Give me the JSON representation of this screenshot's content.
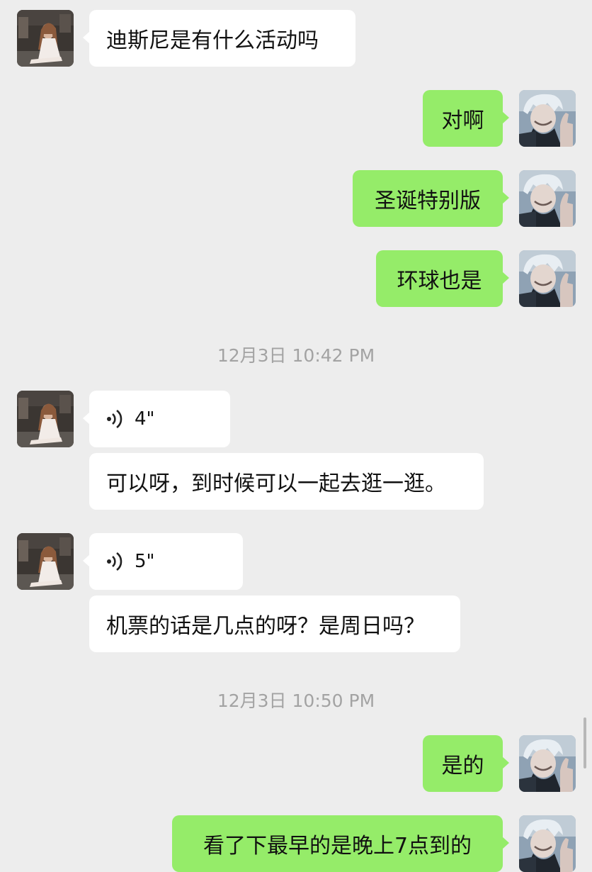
{
  "messages": [
    {
      "text": "迪斯尼是有什么活动吗"
    },
    {
      "text": "对啊"
    },
    {
      "text": "圣诞特别版"
    },
    {
      "text": "环球也是"
    },
    {
      "text": "可以呀，到时候可以一起去逛一逛。"
    },
    {
      "text": "机票的话是几点的呀？是周日吗？"
    },
    {
      "text": "是的"
    },
    {
      "text": "看了下最早的是晚上7点到的"
    }
  ],
  "voice_messages": [
    {
      "duration": "4\""
    },
    {
      "duration": "5\""
    }
  ],
  "timestamps": [
    {
      "text": "12月3日 10:42 PM"
    },
    {
      "text": "12月3日 10:50 PM"
    }
  ],
  "colors": {
    "background": "#ededed",
    "incoming_bubble": "#ffffff",
    "outgoing_bubble": "#95ec69",
    "timestamp_text": "#a3a3a3"
  },
  "icons": {
    "voice": "voice-wave-icon",
    "contact_avatar": "avatar-woman-photo",
    "self_avatar": "avatar-white-haired-man-thumbs-up"
  }
}
